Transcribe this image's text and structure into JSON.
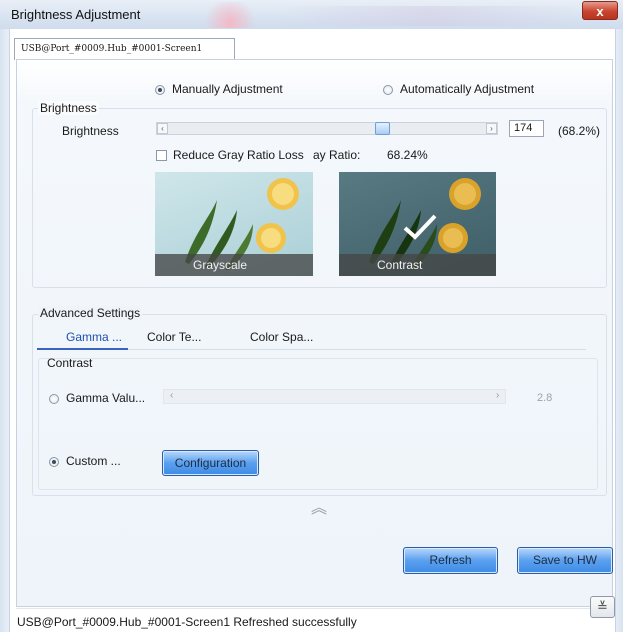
{
  "window": {
    "title": "Brightness Adjustment",
    "close_glyph": "x"
  },
  "screen_tab": {
    "label": "USB@Port_#0009.Hub_#0001-Screen1"
  },
  "mode": {
    "manual_label": "Manually Adjustment",
    "automatic_label": "Automatically Adjustment",
    "selected": "manual"
  },
  "brightness": {
    "group_title": "Brightness",
    "row_label": "Brightness",
    "value": "174",
    "percent": "(68.2%)",
    "slider_fraction": 0.682,
    "reduce_gray_label": "Reduce Gray Ratio Loss",
    "reduce_gray_checked": false,
    "gray_ratio_label": "ay Ratio:",
    "gray_ratio_value": "68.24%"
  },
  "previews": {
    "grayscale_label": "Grayscale",
    "contrast_label": "Contrast",
    "selected": "contrast"
  },
  "advanced": {
    "group_title": "Advanced Settings",
    "tabs": [
      {
        "label": "Gamma ...",
        "active": true
      },
      {
        "label": "Color Te...",
        "active": false
      },
      {
        "label": "Color Spa...",
        "active": false
      }
    ],
    "contrast_title": "Contrast",
    "gamma_label": "Gamma Valu...",
    "gamma_value": "2.8",
    "custom_label": "Custom ...",
    "selected_option": "custom",
    "configuration_button": "Configuration"
  },
  "actions": {
    "collapse_glyph": "︽",
    "refresh_label": "Refresh",
    "save_label": "Save to HW"
  },
  "status": {
    "text": "USB@Port_#0009.Hub_#0001-Screen1 Refreshed successfully",
    "expand_glyph": "≚"
  },
  "colors": {
    "accent": "#3e8be6",
    "tab_underline": "#3a62c0",
    "title_bar": "#d8e3f1",
    "close_button": "#c8452f"
  }
}
